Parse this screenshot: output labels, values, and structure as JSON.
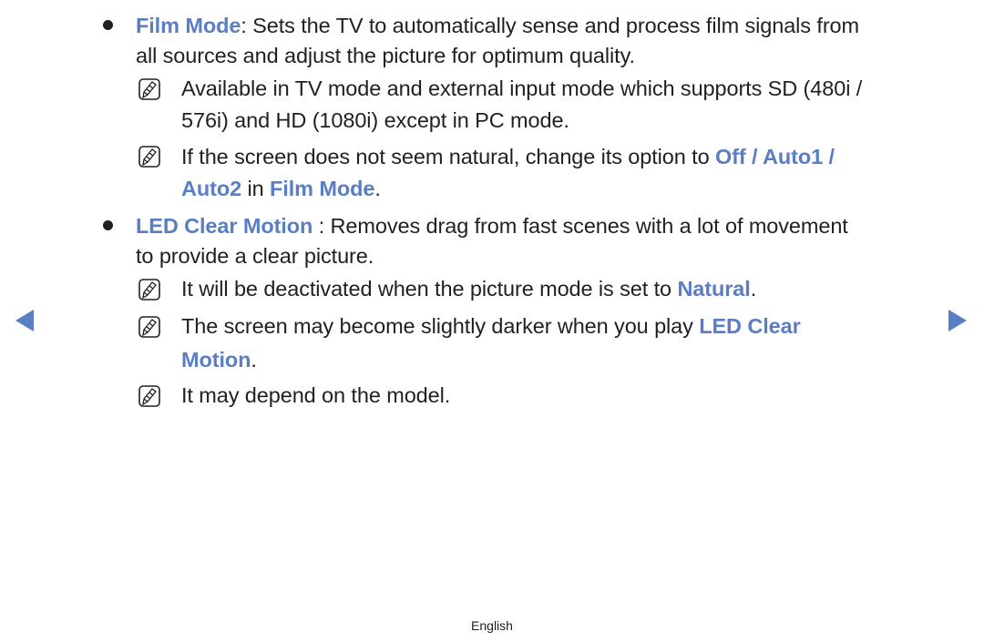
{
  "colors": {
    "accent": "#5a7ec4",
    "text": "#231f20"
  },
  "items": [
    {
      "term": "Film Mode",
      "sep": ": ",
      "desc_line1": "Sets the TV to automatically sense and process film signals from",
      "desc_line2": "all sources and adjust the picture for optimum quality.",
      "notes": [
        {
          "line1": "Available in TV mode and external input mode which supports SD (480i /",
          "line2": "576i) and HD (1080i) except in PC mode."
        },
        {
          "line1_text": "If the screen does not seem natural, change its option to ",
          "line1_hl": "Off / Auto1 /",
          "line2_hl1": "Auto2",
          "line2_mid": " in ",
          "line2_hl2": "Film Mode",
          "line2_end": "."
        }
      ]
    },
    {
      "term": "LED Clear Motion",
      "sep": " : ",
      "desc_line1": "Removes drag from fast scenes with a lot of movement",
      "desc_line2": "to provide a clear picture.",
      "notes": [
        {
          "text": "It will be deactivated when the picture mode is set to ",
          "hl": "Natural",
          "end": "."
        },
        {
          "line1_text": "The screen may become slightly darker when you play ",
          "line1_hl": "LED Clear",
          "line2_hl": "Motion",
          "line2_end": "."
        },
        {
          "text": "It may depend on the model."
        }
      ]
    }
  ],
  "navigation": {
    "prev_icon": "triangle-left",
    "next_icon": "triangle-right"
  },
  "footer": {
    "language": "English"
  }
}
